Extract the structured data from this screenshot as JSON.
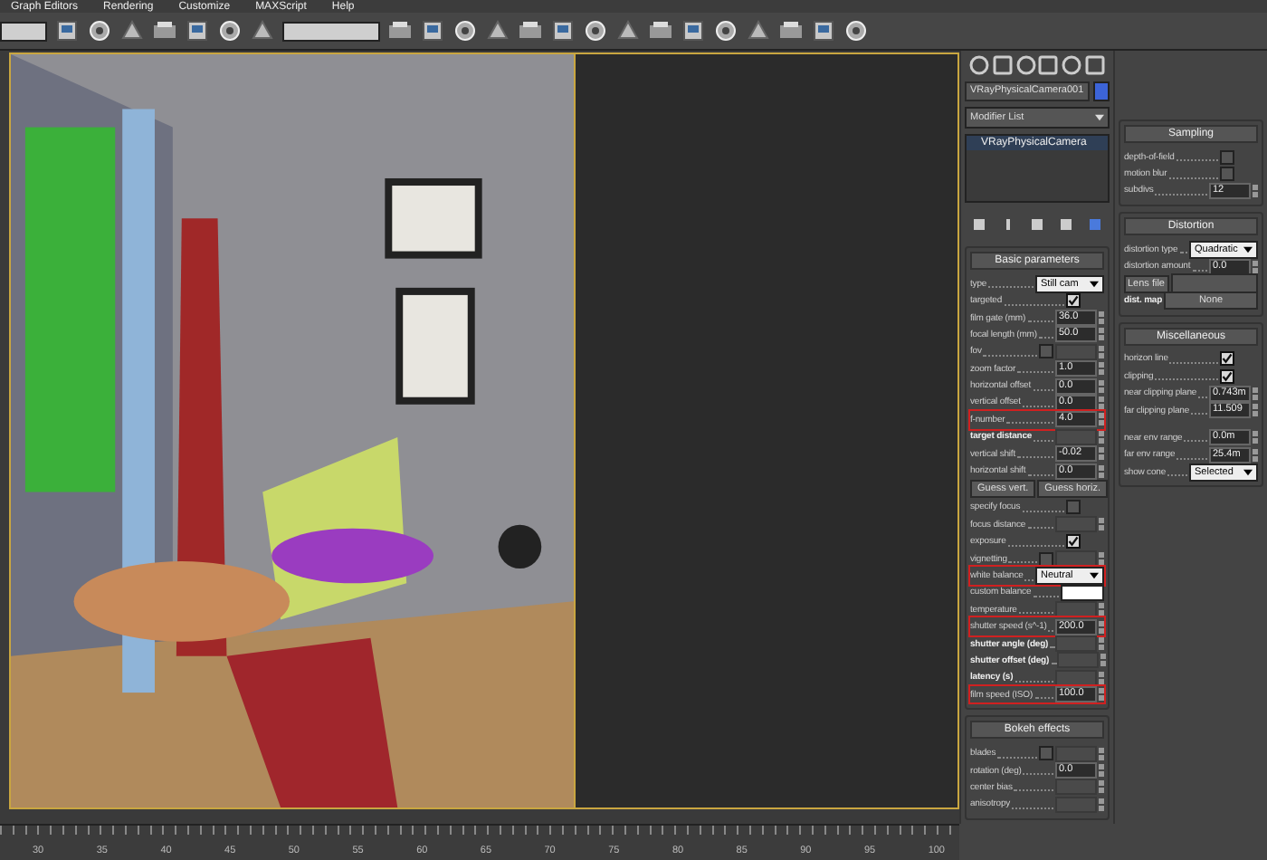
{
  "menu": [
    "Graph Editors",
    "Rendering",
    "Customize",
    "MAXScript",
    "Help"
  ],
  "command_panel": {
    "object_name": "VRayPhysicalCamera001",
    "modifier_list": "Modifier List",
    "stack": [
      {
        "label": "VRayPhysicalCamera",
        "selected": true
      }
    ]
  },
  "basic_parameters": {
    "title": "Basic parameters",
    "rows": [
      {
        "kind": "dropdown",
        "label": "type",
        "value": "Still cam",
        "highlighted": false
      },
      {
        "kind": "check",
        "label": "targeted",
        "checked": true
      },
      {
        "kind": "spinner",
        "label": "film gate (mm)",
        "value": "36.0",
        "highlighted": false,
        "bold": false
      },
      {
        "kind": "spinner",
        "label": "focal length (mm)",
        "value": "50.0",
        "highlighted": false,
        "bold": false
      },
      {
        "kind": "check-spinner",
        "label": "fov",
        "checked": false
      },
      {
        "kind": "spinner",
        "label": "zoom factor",
        "value": "1.0",
        "highlighted": false,
        "bold": false
      },
      {
        "kind": "spinner",
        "label": "horizontal offset",
        "value": "0.0",
        "highlighted": false,
        "bold": false
      },
      {
        "kind": "spinner",
        "label": "vertical offset",
        "value": "0.0",
        "highlighted": false,
        "bold": false
      },
      {
        "kind": "spinner",
        "label": "f-number",
        "value": "4.0",
        "highlighted": true,
        "bold": false
      },
      {
        "kind": "spinner",
        "label": "target distance",
        "highlighted": false,
        "bold": true
      },
      {
        "kind": "spinner",
        "label": "vertical shift",
        "value": "-0.02",
        "highlighted": false,
        "bold": false
      },
      {
        "kind": "spinner",
        "label": "horizontal shift",
        "value": "0.0",
        "highlighted": false,
        "bold": false
      },
      {
        "kind": "buttons",
        "buttons": [
          "Guess vert.",
          "Guess horiz."
        ]
      },
      {
        "kind": "check",
        "label": "specify focus",
        "checked": false
      },
      {
        "kind": "spinner",
        "label": "focus distance",
        "highlighted": false,
        "bold": false
      },
      {
        "kind": "check",
        "label": "exposure",
        "checked": true
      },
      {
        "kind": "check-spinner",
        "label": "vignetting",
        "checked": false
      },
      {
        "kind": "dropdown",
        "label": "white balance",
        "value": "Neutral",
        "highlighted": true
      },
      {
        "kind": "color",
        "label": "custom balance",
        "color": "#ffffff"
      },
      {
        "kind": "spinner",
        "label": "temperature",
        "highlighted": false,
        "bold": false
      },
      {
        "kind": "spinner",
        "label": "shutter speed (s^-1)",
        "value": "200.0",
        "highlighted": true,
        "bold": false
      },
      {
        "kind": "spinner",
        "label": "shutter angle (deg)",
        "highlighted": false,
        "bold": true
      },
      {
        "kind": "spinner",
        "label": "shutter offset (deg)",
        "highlighted": false,
        "bold": true
      },
      {
        "kind": "spinner",
        "label": "latency (s)",
        "highlighted": false,
        "bold": true
      },
      {
        "kind": "spinner",
        "label": "film speed (ISO)",
        "value": "100.0",
        "highlighted": true,
        "bold": false
      }
    ]
  },
  "bokeh_effects": {
    "title": "Bokeh effects",
    "rows": [
      {
        "kind": "check-spinner",
        "label": "blades",
        "checked": false
      },
      {
        "kind": "spinner",
        "label": "rotation (deg)",
        "value": "0.0",
        "highlighted": false,
        "bold": false
      },
      {
        "kind": "spinner",
        "label": "center bias",
        "highlighted": false,
        "bold": false
      },
      {
        "kind": "spinner",
        "label": "anisotropy",
        "highlighted": false,
        "bold": false
      }
    ]
  },
  "sampling": {
    "title": "Sampling",
    "rows": [
      {
        "kind": "check",
        "label": "depth-of-field",
        "checked": false
      },
      {
        "kind": "check",
        "label": "motion blur",
        "checked": false
      },
      {
        "kind": "spinner",
        "label": "subdivs",
        "value": "12",
        "highlighted": false,
        "bold": false
      }
    ]
  },
  "distortion": {
    "title": "Distortion",
    "rows": [
      {
        "kind": "dropdown",
        "label": "distortion type",
        "value": "Quadratic",
        "highlighted": false
      },
      {
        "kind": "spinner",
        "label": "distortion amount",
        "value": "0.0",
        "highlighted": false,
        "bold": false
      },
      {
        "kind": "file",
        "button": "Lens file"
      },
      {
        "kind": "map",
        "label": "dist. map",
        "button": "None"
      }
    ]
  },
  "miscellaneous": {
    "title": "Miscellaneous",
    "rows": [
      {
        "kind": "check",
        "label": "horizon line",
        "checked": true
      },
      {
        "kind": "check",
        "label": "clipping",
        "checked": true
      },
      {
        "kind": "spinner",
        "label": "near clipping plane",
        "value": "0.743m",
        "highlighted": false,
        "bold": false
      },
      {
        "kind": "spinner",
        "label": "far clipping plane",
        "value": "11.509",
        "highlighted": false,
        "bold": false
      },
      {
        "kind": "gap"
      },
      {
        "kind": "spinner",
        "label": "near env range",
        "value": "0.0m",
        "highlighted": false,
        "bold": false
      },
      {
        "kind": "spinner",
        "label": "far env range",
        "value": "25.4m",
        "highlighted": false,
        "bold": false
      },
      {
        "kind": "dropdown",
        "label": "show cone",
        "value": "Selected",
        "highlighted": false
      }
    ]
  },
  "timeline": {
    "ticks": [
      "30",
      "35",
      "40",
      "45",
      "50",
      "55",
      "60",
      "65",
      "70",
      "75",
      "80",
      "85",
      "90",
      "95",
      "100"
    ]
  }
}
